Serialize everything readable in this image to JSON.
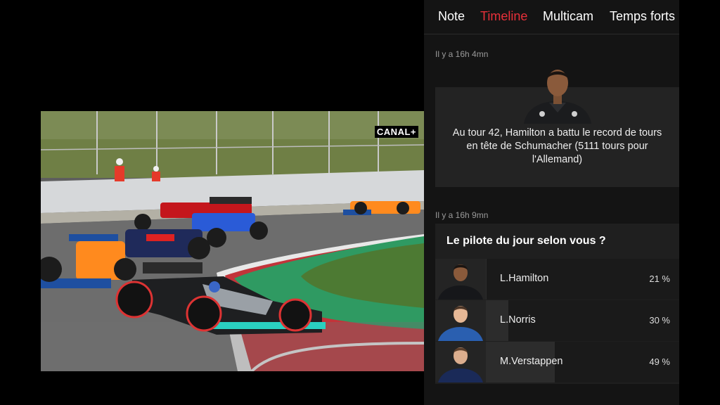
{
  "video": {
    "broadcaster_logo": "CANAL+"
  },
  "panel": {
    "tabs": [
      {
        "label": "Note",
        "active": false
      },
      {
        "label": "Timeline",
        "active": true
      },
      {
        "label": "Multicam",
        "active": false
      },
      {
        "label": "Temps forts",
        "active": false
      }
    ],
    "accent_color": "#e8303a",
    "timeline": [
      {
        "time": "Il y a 16h 4mn",
        "text": "Au tour 42, Hamilton a battu le record de tours en tête de Schumacher (5111 tours pour l'Allemand)"
      },
      {
        "time": "Il y a 16h 9mn",
        "poll": {
          "title": "Le pilote du jour selon vous ?",
          "options": [
            {
              "name": "L.Hamilton",
              "percent": "21 %",
              "value": 21
            },
            {
              "name": "L.Norris",
              "percent": "30 %",
              "value": 30
            },
            {
              "name": "M.Verstappen",
              "percent": "49 %",
              "value": 49
            }
          ]
        }
      }
    ]
  }
}
